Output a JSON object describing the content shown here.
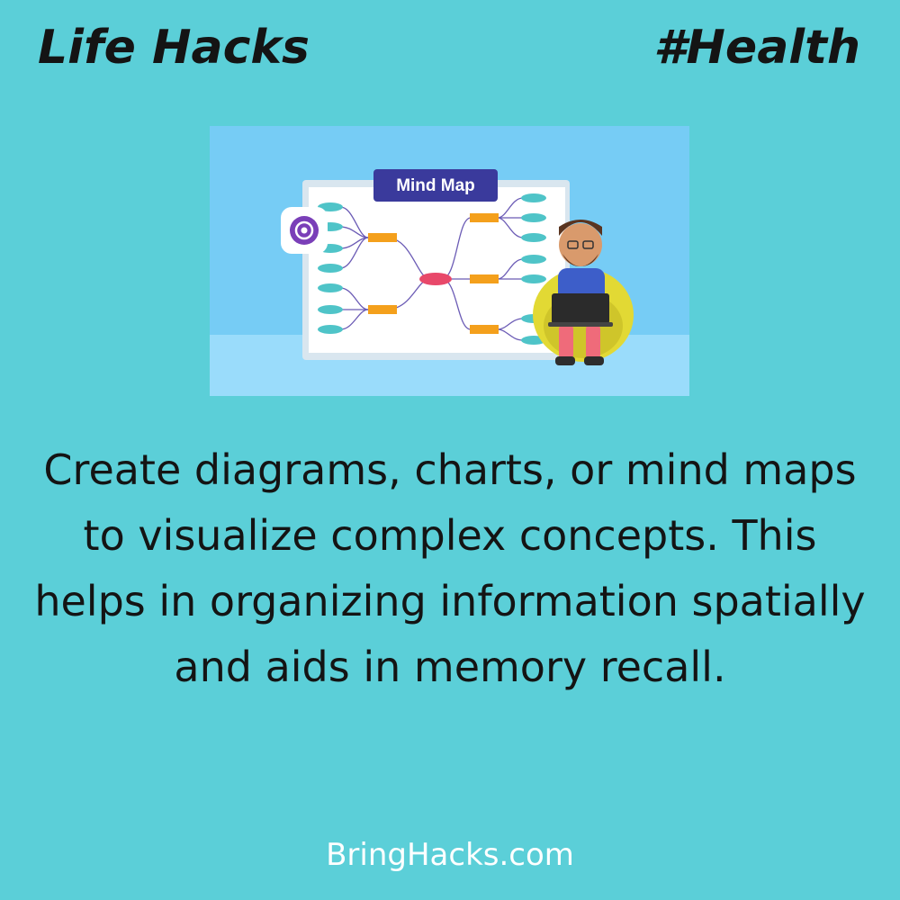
{
  "header": {
    "left_title": "Life Hacks",
    "right_tag": "#Health"
  },
  "illustration": {
    "board_title": "Mind Map",
    "badge_icon": "at-sign-icon",
    "colors": {
      "sky": "#76ccf5",
      "floor": "#9adcfb",
      "board_title_bg": "#3a3a9c",
      "node_orange": "#f4a01c",
      "node_teal": "#4fc4c8",
      "center_node": "#e8486a",
      "chair": "#e2d934"
    }
  },
  "body": {
    "text": "Create diagrams, charts, or mind maps to visualize complex concepts. This helps in organizing information spatially and aids in memory recall."
  },
  "footer": {
    "site": "BringHacks.com"
  }
}
